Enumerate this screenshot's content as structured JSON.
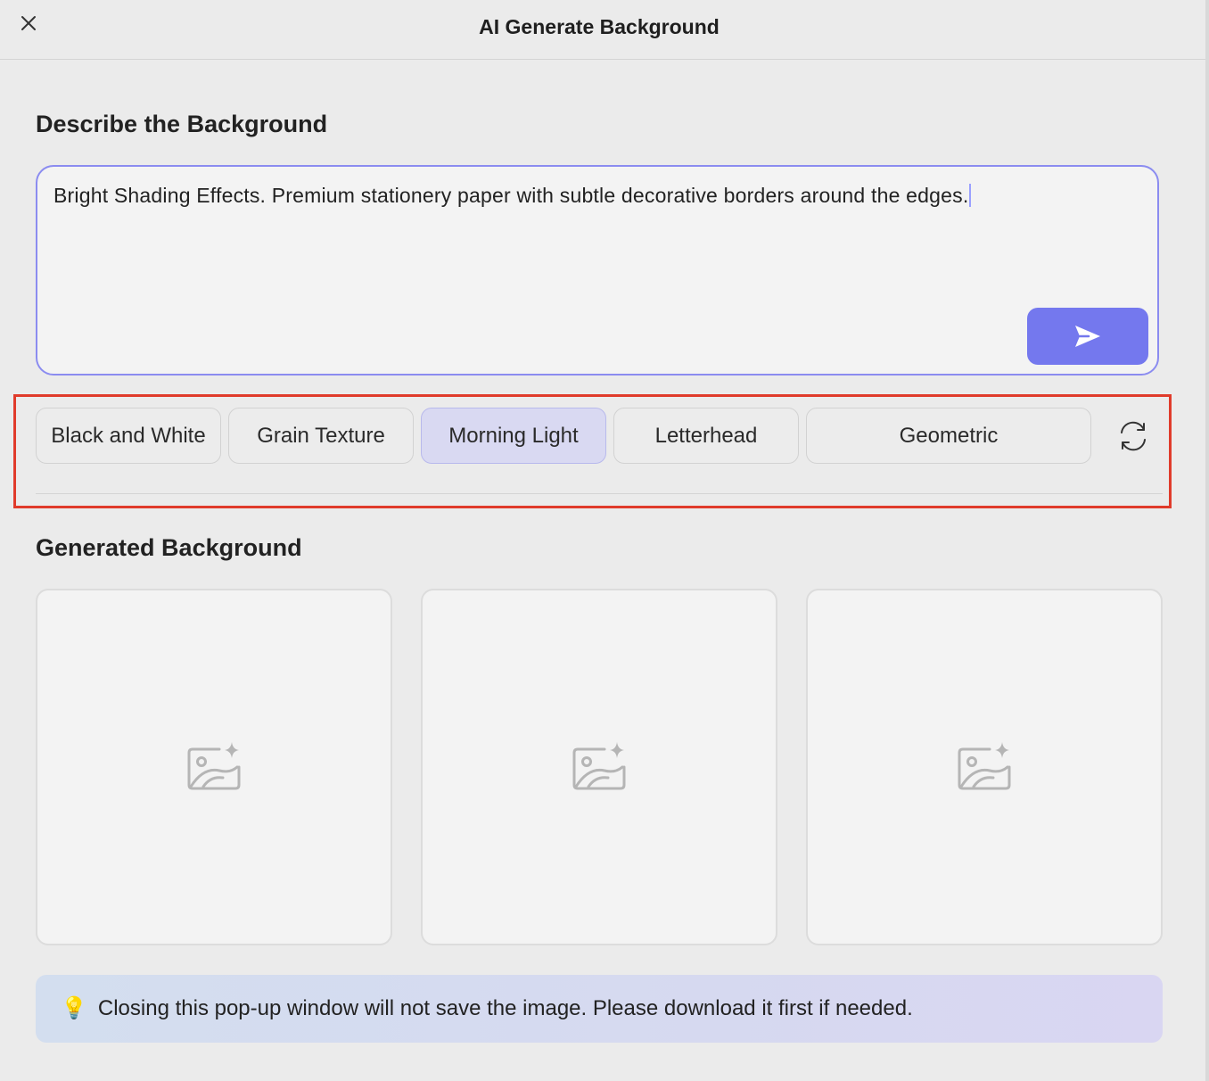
{
  "window": {
    "title": "AI Generate Background"
  },
  "describe_section": {
    "title": "Describe the Background",
    "prompt_value": "Bright Shading Effects. Premium stationery paper with subtle decorative borders around the edges."
  },
  "style_chips": [
    {
      "label": "Black and White",
      "selected": false
    },
    {
      "label": "Grain Texture",
      "selected": false
    },
    {
      "label": "Morning Light",
      "selected": true
    },
    {
      "label": "Letterhead",
      "selected": false
    },
    {
      "label": "Geometric",
      "selected": false
    }
  ],
  "generated_section": {
    "title": "Generated Background",
    "placeholder_icon": "image-sparkle-icon",
    "card_count": 3
  },
  "notice": {
    "icon": "💡",
    "text": "Closing this pop-up window will not save the image. Please download it first if needed."
  },
  "colors": {
    "accent": "#7478ee",
    "selected_chip_bg": "#d9d9f2",
    "highlight_frame": "#e03b2b",
    "window_bg": "#ebebeb"
  },
  "icons": {
    "close": "close-icon",
    "send": "send-icon",
    "refresh": "refresh-icon"
  }
}
